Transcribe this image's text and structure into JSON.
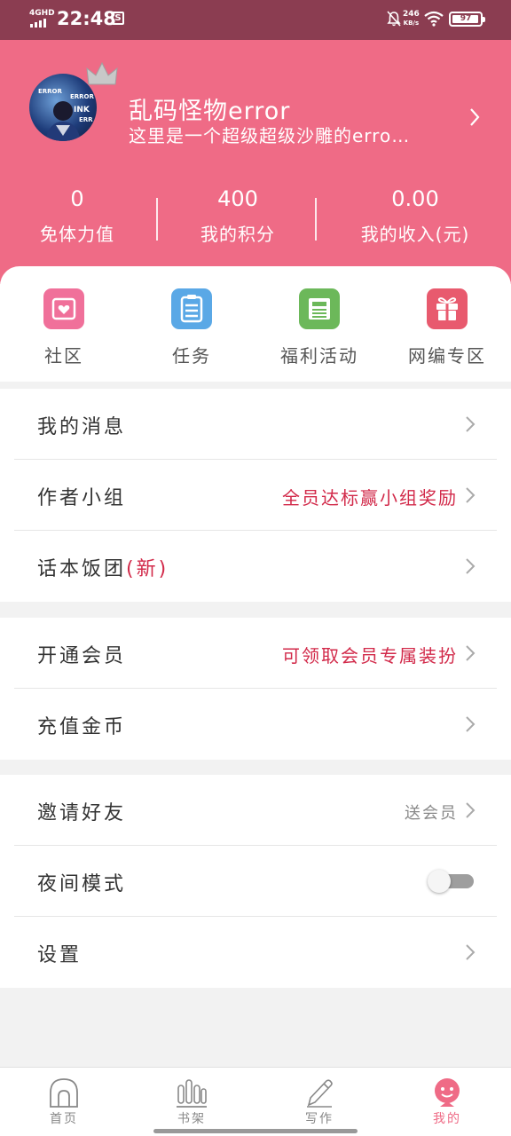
{
  "status_bar": {
    "network": "4GHD",
    "time": "22:48",
    "app_icon": "S",
    "speed_value": "246",
    "speed_unit": "KB/s",
    "battery": "97",
    "battery_level": 0.97
  },
  "profile": {
    "username": "乱码怪物error",
    "bio": "这里是一个超级超级沙雕的erro…",
    "avatar_text": [
      "ERROR",
      "INK",
      "ERR"
    ]
  },
  "stats": [
    {
      "value": "0",
      "label": "免体力值"
    },
    {
      "value": "400",
      "label": "我的积分"
    },
    {
      "value": "0.00",
      "label": "我的收入(元)"
    }
  ],
  "quick_links": [
    {
      "label": "社区",
      "icon": "community-icon",
      "color": "#f0709a"
    },
    {
      "label": "任务",
      "icon": "task-clipboard-icon",
      "color": "#5aa8e6"
    },
    {
      "label": "福利活动",
      "icon": "news-icon",
      "color": "#6cb85a"
    },
    {
      "label": "网编专区",
      "icon": "gift-icon",
      "color": "#e85a6e"
    }
  ],
  "menu": {
    "messages": {
      "label": "我的消息"
    },
    "author_group": {
      "label": "作者小组",
      "extra": "全员达标赢小组奖励"
    },
    "fan_group": {
      "label": "话本饭团",
      "badge": "(新)"
    },
    "vip": {
      "label": "开通会员",
      "extra": "可领取会员专属装扮"
    },
    "recharge": {
      "label": "充值金币"
    },
    "invite": {
      "label": "邀请好友",
      "extra": "送会员"
    },
    "night_mode": {
      "label": "夜间模式",
      "enabled": false
    },
    "settings": {
      "label": "设置"
    }
  },
  "tabs": [
    {
      "label": "首页",
      "icon": "home-icon"
    },
    {
      "label": "书架",
      "icon": "bookshelf-icon"
    },
    {
      "label": "写作",
      "icon": "pen-icon"
    },
    {
      "label": "我的",
      "icon": "profile-icon",
      "active": true
    }
  ],
  "colors": {
    "accent": "#ef6b86",
    "status_bar": "#8b3d51",
    "highlight_text": "#d22a4a"
  }
}
